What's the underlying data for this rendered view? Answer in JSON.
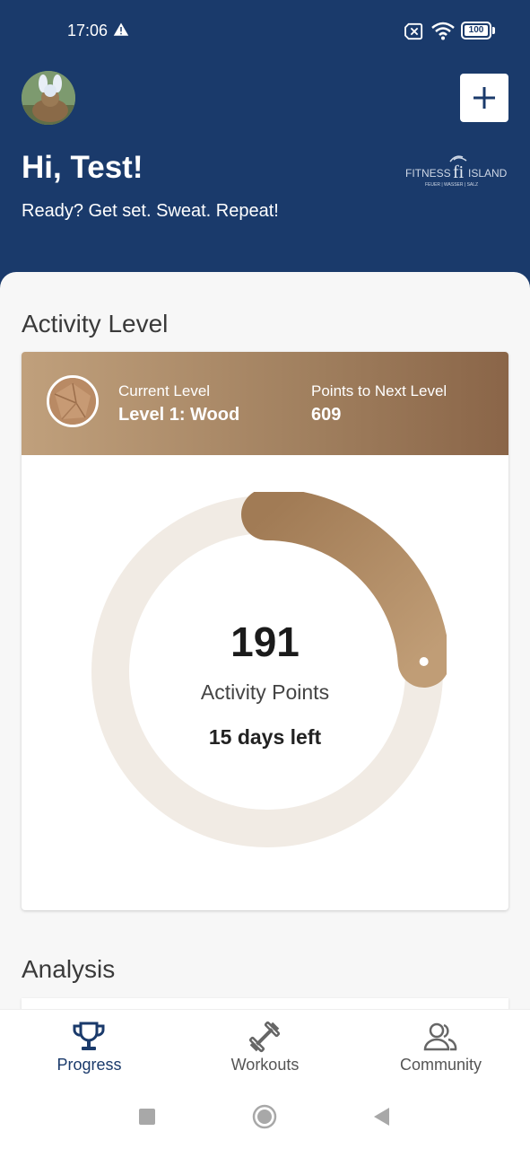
{
  "status_bar": {
    "time": "17:06",
    "battery": "100",
    "icons": [
      "warning-icon",
      "no-sim-icon",
      "wifi-icon",
      "battery-icon"
    ]
  },
  "header": {
    "greeting": "Hi, Test!",
    "tagline": "Ready? Get set. Sweat. Repeat!",
    "logo_main": "FITNESS ISLAND",
    "logo_sub": "FEUER | WASSER | SALZ",
    "add_button_icon": "plus-icon",
    "colors": {
      "background": "#1a3a6b",
      "text": "#ffffff"
    }
  },
  "activity": {
    "title": "Activity Level",
    "current_level_label": "Current Level",
    "current_level_value": "Level 1: Wood",
    "next_level_label": "Points to Next Level",
    "next_level_value": "609",
    "points_value": "191",
    "points_label": "Activity Points",
    "days_left": "15 days left",
    "progress_fraction": 0.24,
    "colors": {
      "banner_start": "#c0a07c",
      "banner_end": "#8a6548",
      "ring_track": "#f1ebe4",
      "ring_progress": "#a8835d"
    }
  },
  "analysis": {
    "title": "Analysis"
  },
  "bottom_nav": {
    "items": [
      {
        "label": "Progress",
        "icon": "trophy-icon",
        "active": true
      },
      {
        "label": "Workouts",
        "icon": "dumbbell-icon",
        "active": false
      },
      {
        "label": "Community",
        "icon": "users-icon",
        "active": false
      }
    ]
  },
  "system_nav": {
    "icons": [
      "recent-apps-icon",
      "home-icon",
      "back-icon"
    ]
  }
}
